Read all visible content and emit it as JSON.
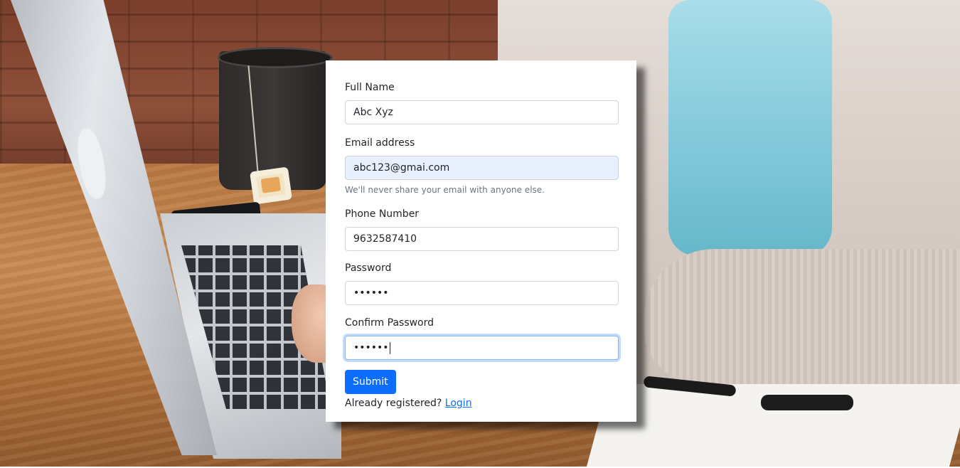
{
  "form": {
    "full_name": {
      "label": "Full Name",
      "value": "Abc Xyz"
    },
    "email": {
      "label": "Email address",
      "value": "abc123@gmai.com",
      "help": "We'll never share your email with anyone else."
    },
    "phone": {
      "label": "Phone Number",
      "value": "9632587410"
    },
    "password": {
      "label": "Password",
      "value": "••••••"
    },
    "confirm_password": {
      "label": "Confirm Password",
      "value": "••••••"
    },
    "submit_label": "Submit",
    "already_registered_text": "Already registered?",
    "login_link": "Login"
  },
  "colors": {
    "primary": "#0d6efd",
    "autofill_bg": "#e8f0fe",
    "card_bg": "#ffffff"
  },
  "background": {
    "icons": [
      "laptop-image",
      "tea-cup-image",
      "person-image"
    ]
  }
}
